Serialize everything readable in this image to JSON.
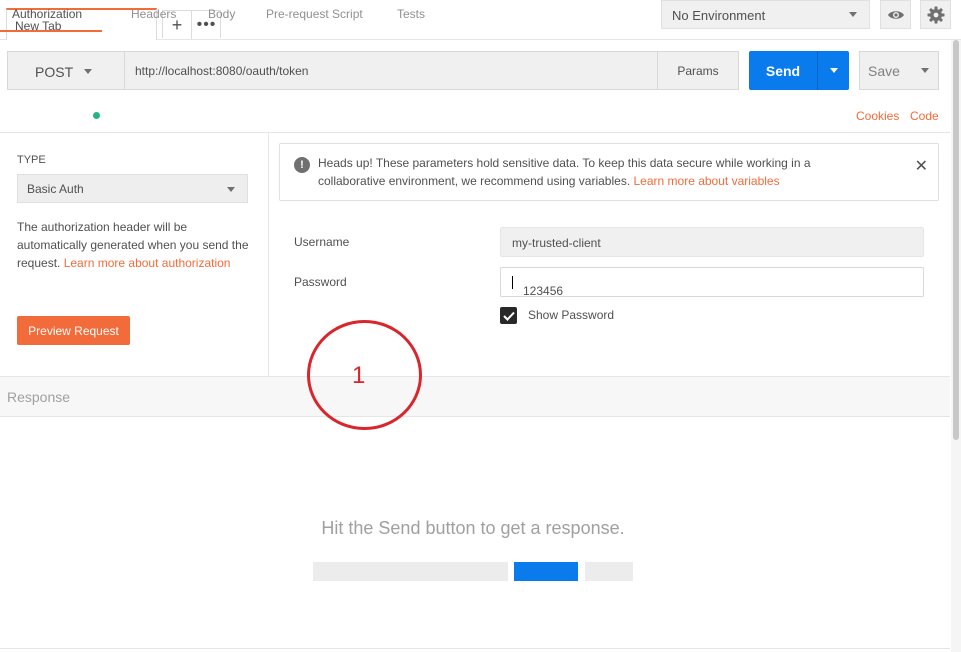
{
  "tabs": [
    {
      "label": "New Tab"
    }
  ],
  "tab_actions": {
    "new_tab": "+",
    "more": "•••"
  },
  "environment": {
    "selected": "No Environment"
  },
  "request": {
    "method": "POST",
    "url": "http://localhost:8080/oauth/token",
    "params_label": "Params",
    "send_label": "Send",
    "save_label": "Save"
  },
  "subtabs": [
    "Authorization",
    "Headers",
    "Body",
    "Pre-request Script",
    "Tests"
  ],
  "right_links": {
    "cookies": "Cookies",
    "code": "Code"
  },
  "auth": {
    "type_label": "TYPE",
    "type_value": "Basic Auth",
    "description": "The authorization header will be automatically generated when you send the request.",
    "learn_more": "Learn more about authorization",
    "preview_button": "Preview Request"
  },
  "alert": {
    "text": "Heads up! These parameters hold sensitive data. To keep this data secure while working in a collaborative environment, we recommend using variables.",
    "link": "Learn more about variables"
  },
  "fields": {
    "username_label": "Username",
    "username_value": "my-trusted-client",
    "password_label": "Password",
    "password_value": "123456",
    "show_password_label": "Show Password"
  },
  "response": {
    "title": "Response",
    "hint": "Hit the Send button to get a response."
  },
  "annotation": {
    "number": "1"
  },
  "colors": {
    "accent": "#f26b3a",
    "primary": "#097bed",
    "dot": "#26b47f",
    "annotation": "#d9262c"
  }
}
